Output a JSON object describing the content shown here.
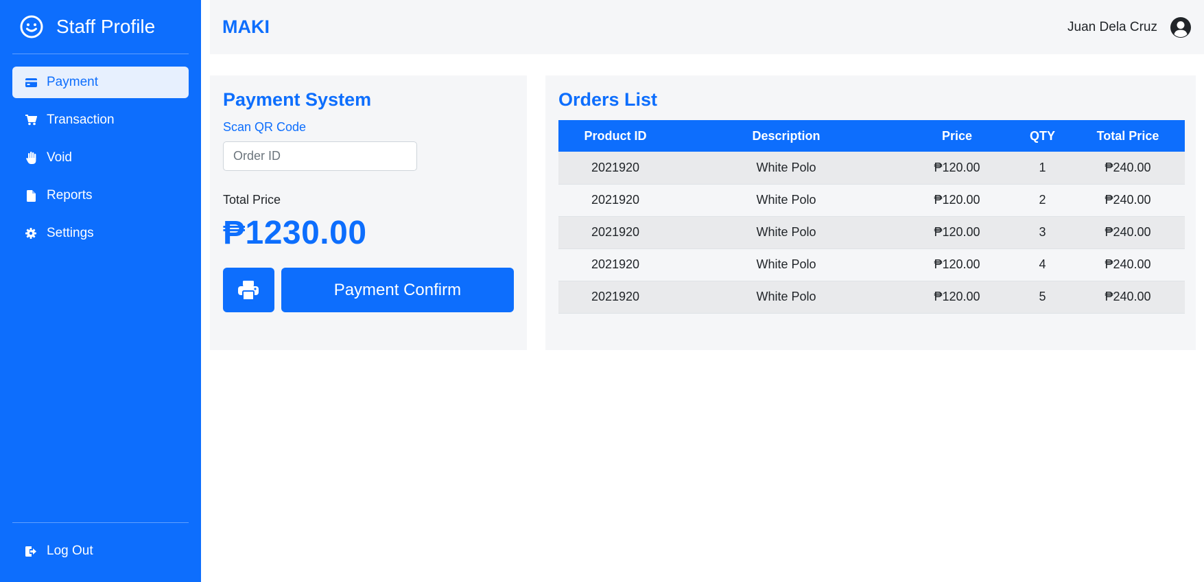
{
  "sidebar": {
    "brand": "Staff Profile",
    "items": [
      {
        "label": "Payment",
        "icon": "credit-card-icon",
        "active": true
      },
      {
        "label": "Transaction",
        "icon": "cart-icon",
        "active": false
      },
      {
        "label": "Void",
        "icon": "hand-icon",
        "active": false
      },
      {
        "label": "Reports",
        "icon": "file-icon",
        "active": false
      },
      {
        "label": "Settings",
        "icon": "gear-icon",
        "active": false
      }
    ],
    "logout_label": "Log Out"
  },
  "topbar": {
    "title": "MAKI",
    "user_name": "Juan Dela Cruz"
  },
  "payment": {
    "title": "Payment System",
    "scan_label": "Scan QR Code",
    "order_placeholder": "Order ID",
    "order_value": "",
    "total_label": "Total Price",
    "total_value": "₱1230.00",
    "confirm_label": "Payment Confirm"
  },
  "orders": {
    "title": "Orders List",
    "columns": [
      "Product ID",
      "Description",
      "Price",
      "QTY",
      "Total Price"
    ],
    "rows": [
      [
        "2021920",
        "White Polo",
        "₱120.00",
        "1",
        "₱240.00"
      ],
      [
        "2021920",
        "White Polo",
        "₱120.00",
        "2",
        "₱240.00"
      ],
      [
        "2021920",
        "White Polo",
        "₱120.00",
        "3",
        "₱240.00"
      ],
      [
        "2021920",
        "White Polo",
        "₱120.00",
        "4",
        "₱240.00"
      ],
      [
        "2021920",
        "White Polo",
        "₱120.00",
        "5",
        "₱240.00"
      ]
    ]
  },
  "colors": {
    "accent": "#0d6efd",
    "panel": "#f5f6f8",
    "active_item_bg": "#e7f0fe"
  }
}
